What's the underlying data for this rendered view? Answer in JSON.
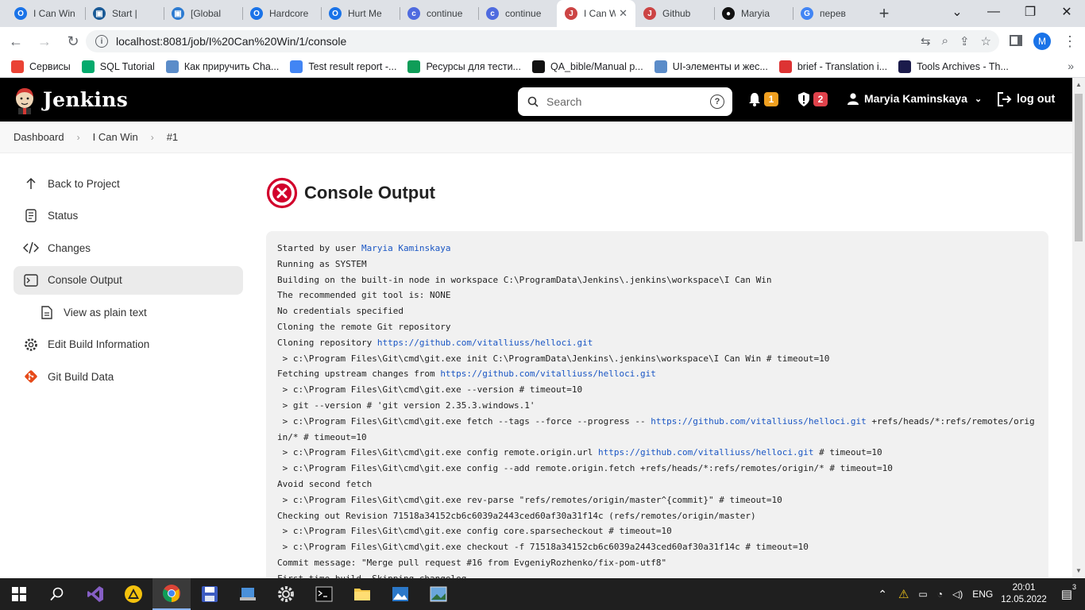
{
  "browser": {
    "tabs": [
      {
        "title": "I Can Win",
        "color": "#1a73e8",
        "glyph": "O"
      },
      {
        "title": "Start | ",
        "color": "#1a5a96",
        "glyph": "▣"
      },
      {
        "title": "[Global",
        "color": "#2d7bd1",
        "glyph": "▣"
      },
      {
        "title": "Hardcore",
        "color": "#1a73e8",
        "glyph": "O"
      },
      {
        "title": "Hurt Me",
        "color": "#1a73e8",
        "glyph": "O"
      },
      {
        "title": "continue",
        "color": "#4f6bdf",
        "glyph": "c"
      },
      {
        "title": "continue",
        "color": "#4f6bdf",
        "glyph": "c"
      },
      {
        "title": "I Can Win",
        "color": "#c44",
        "glyph": "J",
        "active": true
      },
      {
        "title": "Github",
        "color": "#c44",
        "glyph": "J"
      },
      {
        "title": "Maryia",
        "color": "#111",
        "glyph": "●"
      },
      {
        "title": "перев",
        "color": "#4285f4",
        "glyph": "G"
      }
    ],
    "url": "localhost:8081/job/I%20Can%20Win/1/console",
    "profile_initial": "M",
    "bookmarks": [
      {
        "label": "Сервисы",
        "icon": "apps-icon",
        "color": "#ea4335"
      },
      {
        "label": "SQL Tutorial",
        "icon": "w3-icon",
        "color": "#04aa6d"
      },
      {
        "label": "Как приручить Cha...",
        "icon": "bookmark-icon",
        "color": "#5b8cc9"
      },
      {
        "label": "Test result report -...",
        "icon": "doc-icon",
        "color": "#4285f4"
      },
      {
        "label": "Ресурсы для тести...",
        "icon": "sheet-icon",
        "color": "#0f9d58"
      },
      {
        "label": "QA_bible/Manual p...",
        "icon": "github-icon",
        "color": "#111"
      },
      {
        "label": "UI-элементы и жес...",
        "icon": "bookmark-icon",
        "color": "#5b8cc9"
      },
      {
        "label": "brief - Translation i...",
        "icon": "reverso-icon",
        "color": "#d33"
      },
      {
        "label": "Tools Archives - Th...",
        "icon": "qa-icon",
        "color": "#1b1b4b"
      }
    ]
  },
  "jenkins": {
    "brand": "Jenkins",
    "search_placeholder": "Search",
    "notifications_count": "1",
    "security_count": "2",
    "user_name": "Maryia Kaminskaya",
    "logout_label": "log out",
    "breadcrumb": [
      "Dashboard",
      "I Can Win",
      "#1"
    ],
    "side": [
      {
        "label": "Back to Project",
        "icon": "arrow-up-icon"
      },
      {
        "label": "Status",
        "icon": "document-icon"
      },
      {
        "label": "Changes",
        "icon": "code-icon"
      },
      {
        "label": "Console Output",
        "icon": "terminal-icon",
        "active": true
      },
      {
        "label": "View as plain text",
        "icon": "file-icon",
        "sub": true
      },
      {
        "label": "Edit Build Information",
        "icon": "gear-icon"
      },
      {
        "label": "Git Build Data",
        "icon": "git-icon"
      }
    ],
    "page_title": "Console Output",
    "console_lines": [
      [
        {
          "t": "Started by user "
        },
        {
          "t": "Maryia Kaminskaya",
          "link": true
        }
      ],
      [
        {
          "t": "Running as SYSTEM"
        }
      ],
      [
        {
          "t": "Building on the built-in node in workspace C:\\ProgramData\\Jenkins\\.jenkins\\workspace\\I Can Win"
        }
      ],
      [
        {
          "t": "The recommended git tool is: NONE"
        }
      ],
      [
        {
          "t": "No credentials specified"
        }
      ],
      [
        {
          "t": "Cloning the remote Git repository"
        }
      ],
      [
        {
          "t": "Cloning repository "
        },
        {
          "t": "https://github.com/vitalliuss/helloci.git",
          "link": true
        }
      ],
      [
        {
          "t": " > c:\\Program Files\\Git\\cmd\\git.exe init C:\\ProgramData\\Jenkins\\.jenkins\\workspace\\I Can Win # timeout=10"
        }
      ],
      [
        {
          "t": "Fetching upstream changes from "
        },
        {
          "t": "https://github.com/vitalliuss/helloci.git",
          "link": true
        }
      ],
      [
        {
          "t": " > c:\\Program Files\\Git\\cmd\\git.exe --version # timeout=10"
        }
      ],
      [
        {
          "t": " > git --version # 'git version 2.35.3.windows.1'"
        }
      ],
      [
        {
          "t": " > c:\\Program Files\\Git\\cmd\\git.exe fetch --tags --force --progress -- "
        },
        {
          "t": "https://github.com/vitalliuss/helloci.git",
          "link": true
        },
        {
          "t": " +refs/heads/*:refs/remotes/origin/* # timeout=10"
        }
      ],
      [
        {
          "t": " > c:\\Program Files\\Git\\cmd\\git.exe config remote.origin.url "
        },
        {
          "t": "https://github.com/vitalliuss/helloci.git",
          "link": true
        },
        {
          "t": " # timeout=10"
        }
      ],
      [
        {
          "t": " > c:\\Program Files\\Git\\cmd\\git.exe config --add remote.origin.fetch +refs/heads/*:refs/remotes/origin/* # timeout=10"
        }
      ],
      [
        {
          "t": "Avoid second fetch"
        }
      ],
      [
        {
          "t": " > c:\\Program Files\\Git\\cmd\\git.exe rev-parse \"refs/remotes/origin/master^{commit}\" # timeout=10"
        }
      ],
      [
        {
          "t": "Checking out Revision 71518a34152cb6c6039a2443ced60af30a31f14c (refs/remotes/origin/master)"
        }
      ],
      [
        {
          "t": " > c:\\Program Files\\Git\\cmd\\git.exe config core.sparsecheckout # timeout=10"
        }
      ],
      [
        {
          "t": " > c:\\Program Files\\Git\\cmd\\git.exe checkout -f 71518a34152cb6c6039a2443ced60af30a31f14c # timeout=10"
        }
      ],
      [
        {
          "t": "Commit message: \"Merge pull request #16 from EvgeniyRozhenko/fix-pom-utf8\""
        }
      ],
      [
        {
          "t": "First time build. Skipping changelog."
        }
      ]
    ]
  },
  "taskbar": {
    "lang": "ENG",
    "time": "20:01",
    "date": "12.05.2022",
    "notifications": "3"
  }
}
